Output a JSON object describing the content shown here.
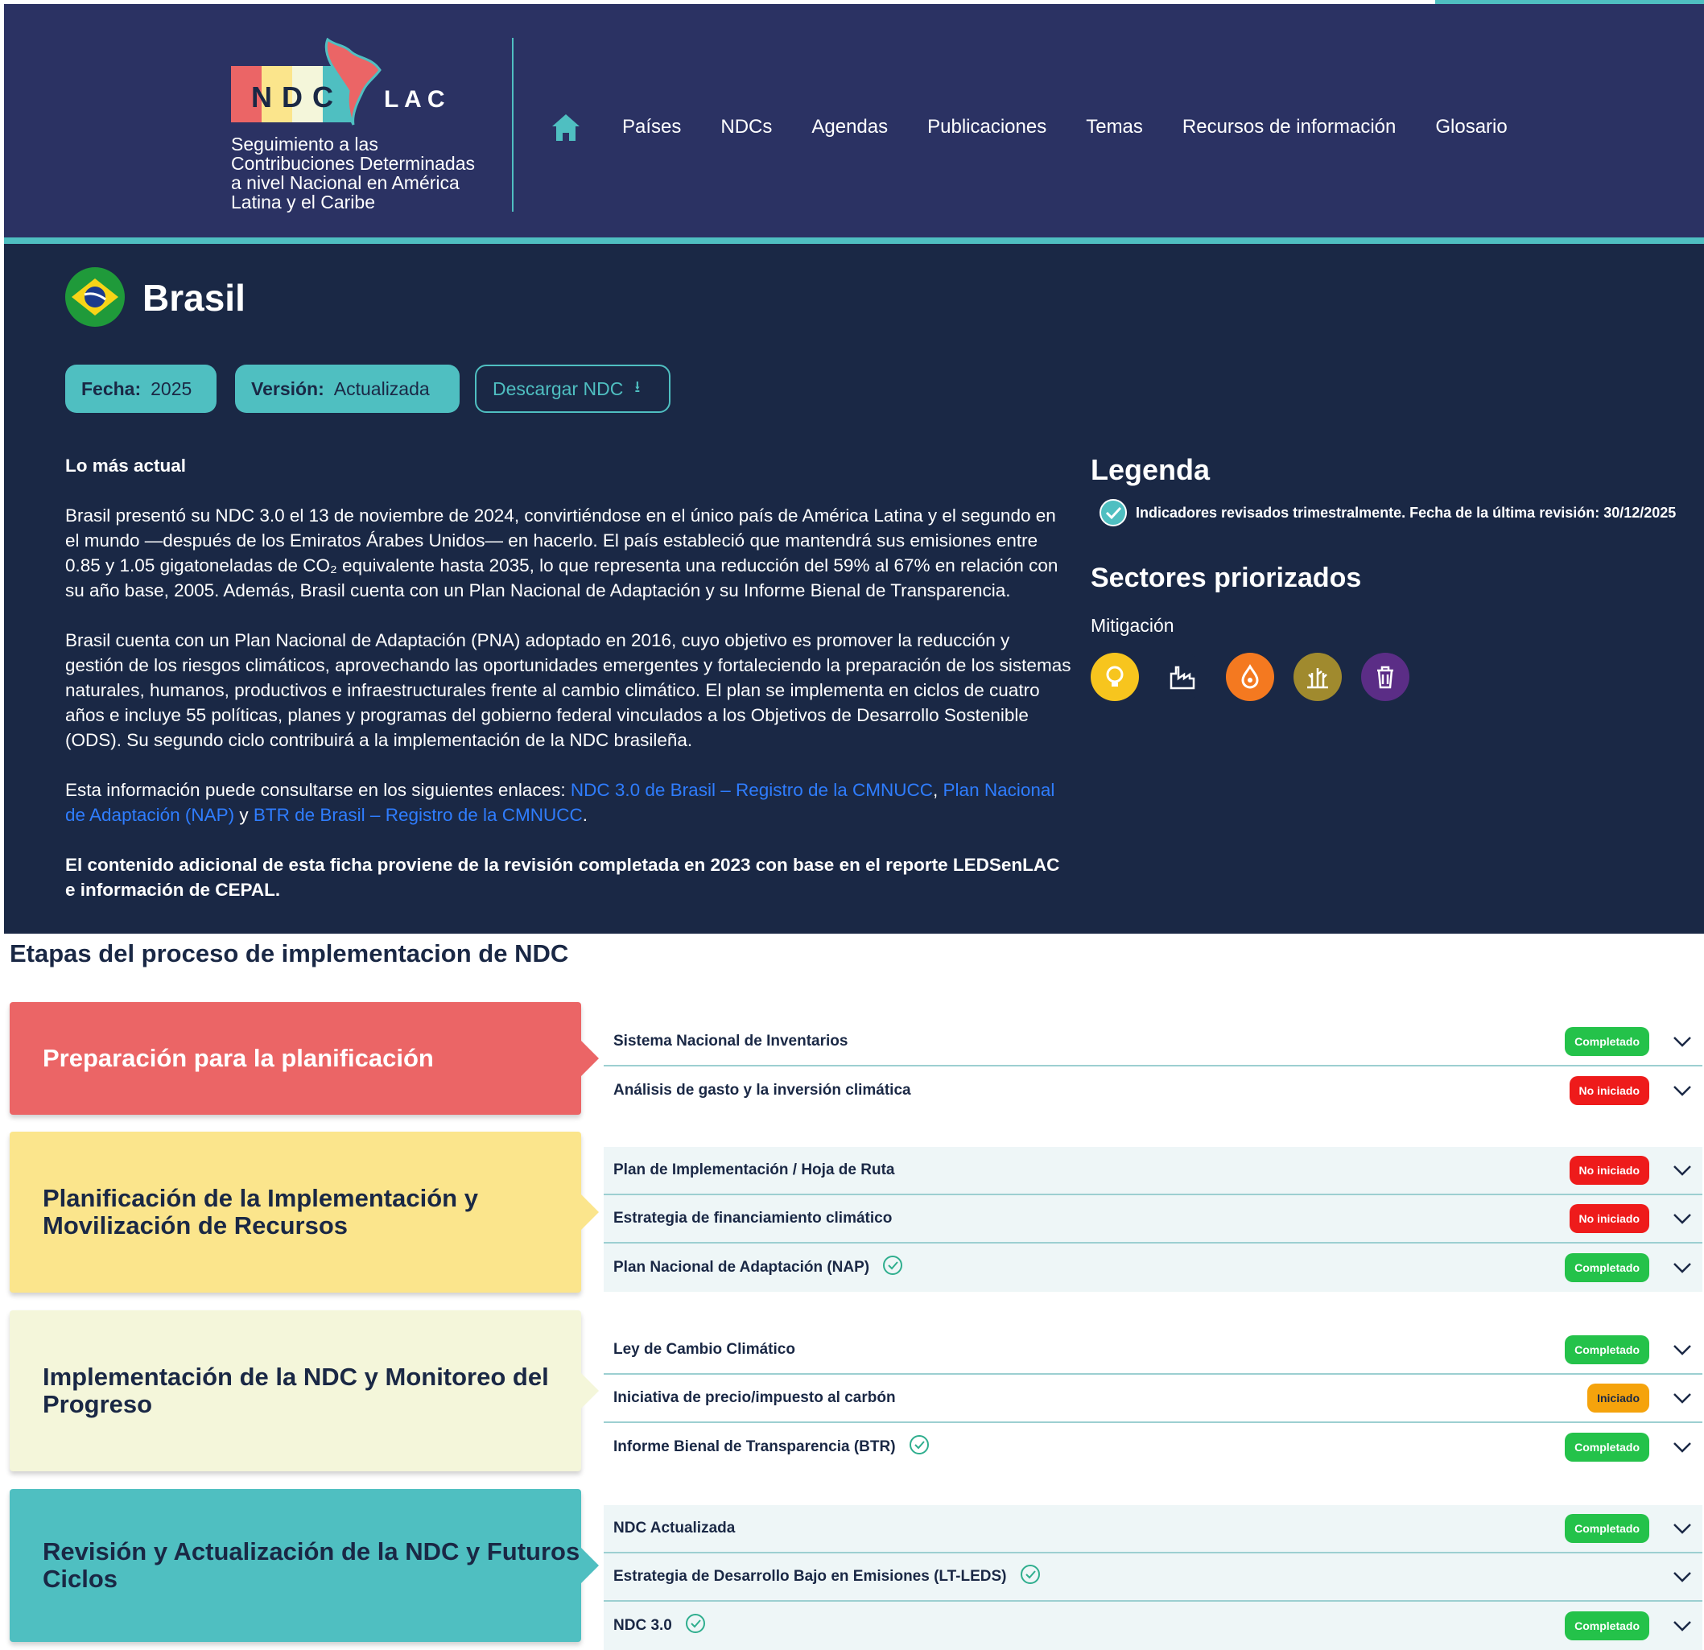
{
  "header": {
    "logo_text": "NDC LAC",
    "logo_subtitle_lines": [
      "Seguimiento a las",
      "Contribuciones Determinadas",
      "a nivel Nacional en América",
      "Latina y el Caribe"
    ],
    "nav": [
      "Países",
      "NDCs",
      "Agendas",
      "Publicaciones",
      "Temas",
      "Recursos de información",
      "Glosario"
    ]
  },
  "country": {
    "name": "Brasil",
    "fecha_label": "Fecha:",
    "fecha_value": "2025",
    "version_label": "Versión:",
    "version_value": "Actualizada",
    "download_label": "Descargar NDC"
  },
  "content": {
    "lead": "Lo más actual",
    "p1": "Brasil presentó su NDC 3.0 el 13 de noviembre de 2024, convirtiéndose en el único país de América Latina y el segundo en el mundo —después de los Emiratos Árabes Unidos— en hacerlo. El país estableció que mantendrá sus emisiones entre 0.85 y 1.05 gigatoneladas de CO₂ equivalente hasta 2035, lo que representa una reducción del 59% al 67% en relación con su año base, 2005. Además, Brasil cuenta con un Plan Nacional de Adaptación y su Informe Bienal de Transparencia.",
    "p2": "Brasil cuenta con un Plan Nacional de Adaptación (PNA) adoptado en 2016, cuyo objetivo es promover la reducción y gestión de los riesgos climáticos, aprovechando las oportunidades emergentes y fortaleciendo la preparación de los sistemas naturales, humanos, productivos e infraestructurales frente al cambio climático. El plan se implementa en ciclos de cuatro años e incluye 55 políticas, planes y programas del gobierno federal vinculados a los Objetivos de Desarrollo Sostenible (ODS). Su segundo ciclo contribuirá a la implementación de la NDC brasileña.",
    "p3_prefix": "Esta información puede consultarse en los siguientes enlaces: ",
    "link1": "NDC 3.0 de Brasil – Registro de la CMNUCC",
    "sep1": ", ",
    "link2": "Plan Nacional de Adaptación (NAP)",
    "sep2": " y ",
    "link3": "BTR de Brasil – Registro de la CMNUCC",
    "p3_suffix": ".",
    "p4": "El contenido adicional de esta ficha proviene de la revisión completada en 2023 con base en el reporte LEDSenLAC e información de CEPAL."
  },
  "legend": {
    "title": "Legenda",
    "item": "Indicadores revisados trimestralmente. Fecha de la última revisión: 30/12/2025"
  },
  "sectors": {
    "title": "Sectores priorizados",
    "subtitle": "Mitigación",
    "icons": [
      {
        "name": "energy-icon",
        "color": "#f7c51e"
      },
      {
        "name": "industry-icon",
        "color": "#1a2845"
      },
      {
        "name": "waste-water-icon",
        "color": "#f47920"
      },
      {
        "name": "agriculture-icon",
        "color": "#a08a2e"
      },
      {
        "name": "waste-icon",
        "color": "#5b2d86"
      }
    ]
  },
  "stages": {
    "title": "Etapas del proceso de implementacion de NDC",
    "groups": [
      {
        "label": "Preparación para la planificación",
        "color": "#eb6566",
        "text_color": "#ffffff",
        "rows": [
          {
            "label": "Sistema Nacional de Inventarios",
            "status": "Completado",
            "check": false
          },
          {
            "label": "Análisis de gasto y la inversión climática",
            "status": "No iniciado",
            "check": false
          }
        ]
      },
      {
        "label": "Planificación de la Implementación y Movilización de Recursos",
        "color": "#fbe58c",
        "text_color": "#1a2845",
        "rows": [
          {
            "label": "Plan de Implementación / Hoja de Ruta",
            "status": "No iniciado",
            "check": false
          },
          {
            "label": "Estrategia de financiamiento climático",
            "status": "No iniciado",
            "check": false
          },
          {
            "label": "Plan Nacional de Adaptación (NAP)",
            "status": "Completado",
            "check": true
          }
        ]
      },
      {
        "label": "Implementación de la NDC y Monitoreo del Progreso",
        "color": "#f4f6da",
        "text_color": "#1a2845",
        "rows": [
          {
            "label": "Ley de Cambio Climático",
            "status": "Completado",
            "check": false
          },
          {
            "label": "Iniciativa de precio/impuesto al carbón",
            "status": "Iniciado",
            "check": false
          },
          {
            "label": "Informe Bienal de Transparencia (BTR)",
            "status": "Completado",
            "check": true
          }
        ]
      },
      {
        "label": "Revisión y Actualización de la NDC y Futuros Ciclos",
        "color": "#4fbfc1",
        "text_color": "#1a2845",
        "rows": [
          {
            "label": "NDC Actualizada",
            "status": "Completado",
            "check": false
          },
          {
            "label": "Estrategia de Desarrollo Bajo en Emisiones (LT-LEDS)",
            "status": "",
            "check": true
          },
          {
            "label": "NDC 3.0",
            "status": "Completado",
            "check": true
          }
        ]
      }
    ]
  }
}
